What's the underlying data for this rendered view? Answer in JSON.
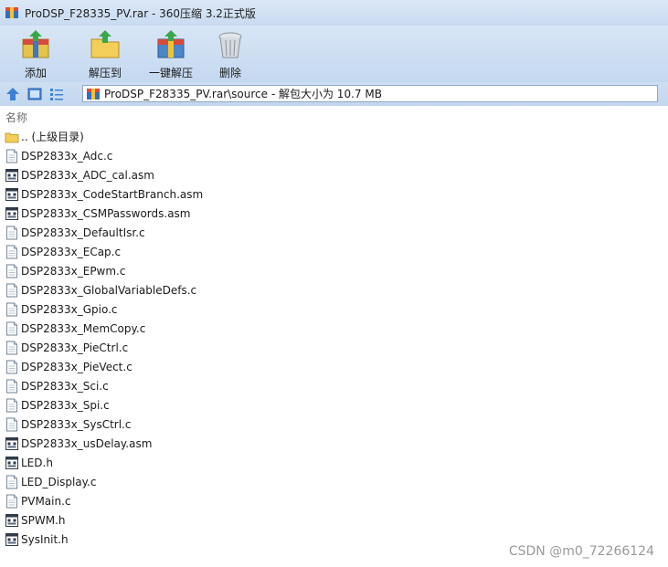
{
  "window": {
    "title": "ProDSP_F28335_PV.rar - 360压缩 3.2正式版"
  },
  "toolbar": {
    "buttons": [
      {
        "label": "添加",
        "icon": "add-archive-icon"
      },
      {
        "label": "解压到",
        "icon": "extract-to-icon"
      },
      {
        "label": "一键解压",
        "icon": "one-click-extract-icon"
      },
      {
        "label": "删除",
        "icon": "delete-icon"
      }
    ]
  },
  "address": {
    "path": "ProDSP_F28335_PV.rar\\source - 解包大小为 10.7 MB"
  },
  "list": {
    "column_name": "名称",
    "parent": ".. (上级目录)",
    "files": [
      {
        "name": "DSP2833x_Adc.c",
        "type": "c"
      },
      {
        "name": "DSP2833x_ADC_cal.asm",
        "type": "asm"
      },
      {
        "name": "DSP2833x_CodeStartBranch.asm",
        "type": "asm"
      },
      {
        "name": "DSP2833x_CSMPasswords.asm",
        "type": "asm"
      },
      {
        "name": "DSP2833x_DefaultIsr.c",
        "type": "c"
      },
      {
        "name": "DSP2833x_ECap.c",
        "type": "c"
      },
      {
        "name": "DSP2833x_EPwm.c",
        "type": "c"
      },
      {
        "name": "DSP2833x_GlobalVariableDefs.c",
        "type": "c"
      },
      {
        "name": "DSP2833x_Gpio.c",
        "type": "c"
      },
      {
        "name": "DSP2833x_MemCopy.c",
        "type": "c"
      },
      {
        "name": "DSP2833x_PieCtrl.c",
        "type": "c"
      },
      {
        "name": "DSP2833x_PieVect.c",
        "type": "c"
      },
      {
        "name": "DSP2833x_Sci.c",
        "type": "c"
      },
      {
        "name": "DSP2833x_Spi.c",
        "type": "c"
      },
      {
        "name": "DSP2833x_SysCtrl.c",
        "type": "c"
      },
      {
        "name": "DSP2833x_usDelay.asm",
        "type": "asm"
      },
      {
        "name": "LED.h",
        "type": "h"
      },
      {
        "name": "LED_Display.c",
        "type": "c"
      },
      {
        "name": "PVMain.c",
        "type": "c"
      },
      {
        "name": "SPWM.h",
        "type": "h"
      },
      {
        "name": "SysInit.h",
        "type": "h"
      }
    ]
  },
  "watermark": "CSDN @m0_72266124"
}
